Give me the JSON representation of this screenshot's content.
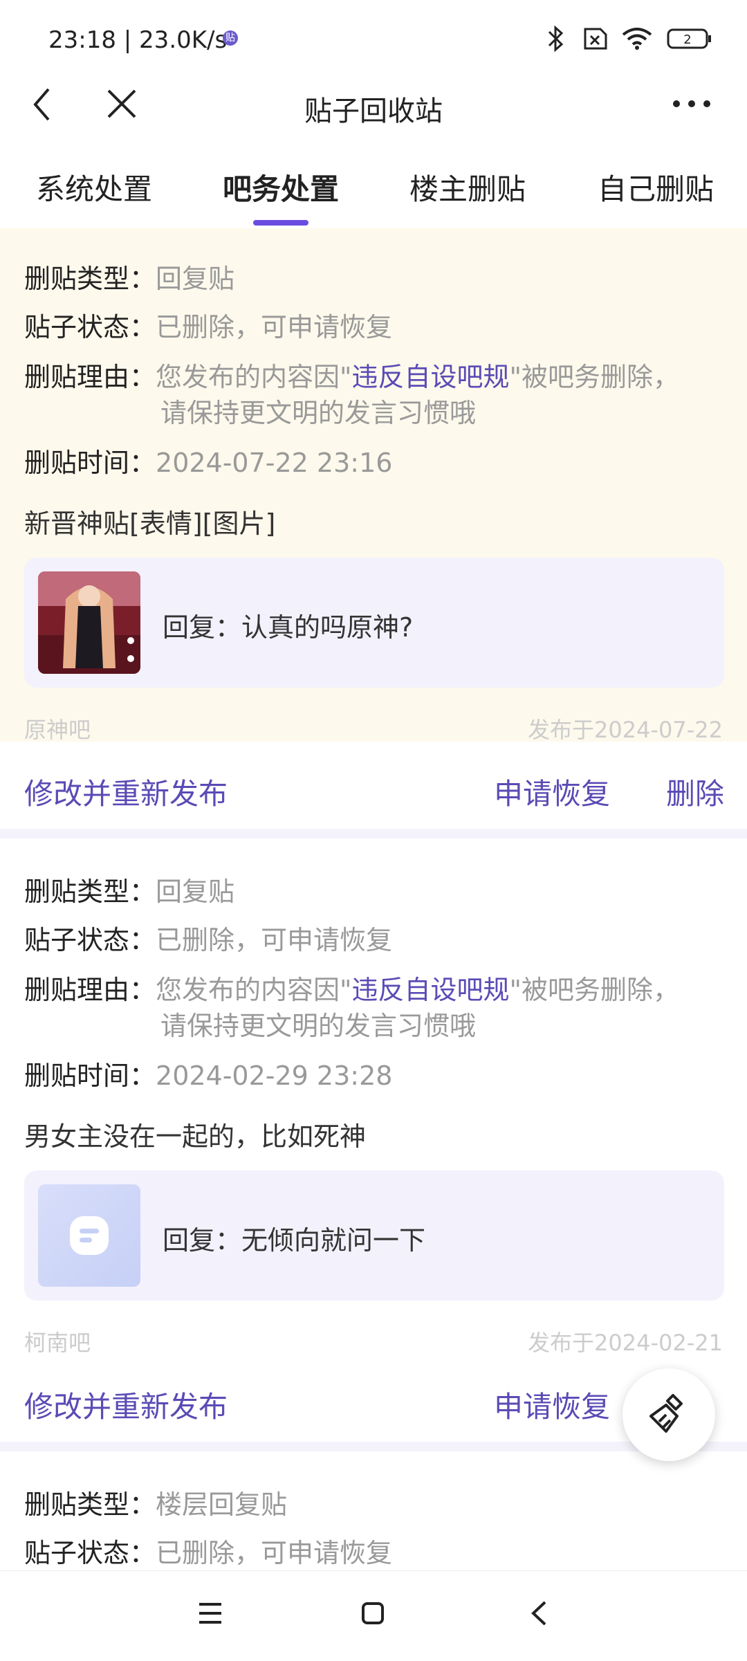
{
  "status_bar": {
    "time": "23:18 | 23.0K/s",
    "app_badge": "贴",
    "battery": "2"
  },
  "header": {
    "title": "贴子回收站"
  },
  "tabs": [
    {
      "label": "系统处置"
    },
    {
      "label": "吧务处置"
    },
    {
      "label": "楼主删贴"
    },
    {
      "label": "自己删贴"
    }
  ],
  "labels": {
    "type": "删贴类型：",
    "status": "贴子状态：",
    "reason": "删贴理由：",
    "time": "删贴时间："
  },
  "posts": [
    {
      "type": "回复贴",
      "status": "已删除，可申请恢复",
      "reason_pre": "您发布的内容因\"",
      "reason_link": "违反自设吧规",
      "reason_post": "\"被吧务删除，",
      "reason_line2": "请保持更文明的发言习惯哦",
      "time": "2024-07-22 23:16",
      "post_title": "新晋神贴[表情][图片]",
      "quote": "回复：认真的吗原神?",
      "forum": "原神吧",
      "published": "发布于2024-07-22",
      "actions": {
        "edit": "修改并重新发布",
        "restore": "申请恢复",
        "delete": "删除"
      }
    },
    {
      "type": "回复贴",
      "status": "已删除，可申请恢复",
      "reason_pre": "您发布的内容因\"",
      "reason_link": "违反自设吧规",
      "reason_post": "\"被吧务删除，",
      "reason_line2": "请保持更文明的发言习惯哦",
      "time": "2024-02-29 23:28",
      "post_title": "男女主没在一起的，比如死神",
      "quote": "回复：无倾向就问一下",
      "forum": "柯南吧",
      "published": "发布于2024-02-21",
      "actions": {
        "edit": "修改并重新发布",
        "restore": "申请恢复"
      }
    },
    {
      "type": "楼层回复贴",
      "status": "已删除，可申请恢复"
    }
  ]
}
